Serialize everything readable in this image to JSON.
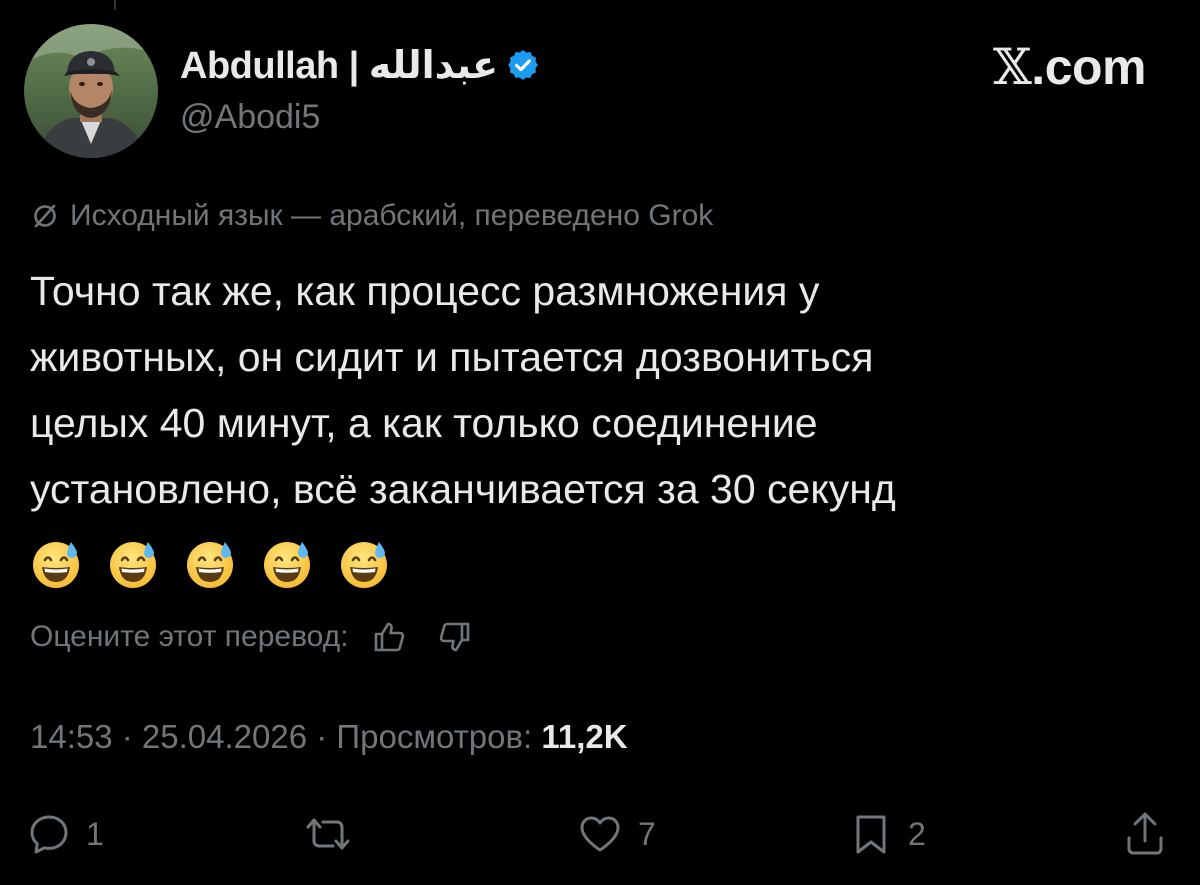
{
  "author": {
    "display_name": "Abdullah | عبدالله",
    "handle": "@Abodi5",
    "verified": true
  },
  "brand": {
    "symbol": "𝕏",
    "domain": ".com"
  },
  "translation": {
    "note": "Исходный язык — арабский, переведено Grok"
  },
  "tweet": {
    "lines": [
      "Точно так же, как процесс размножения у",
      "животных, он сидит и пытается дозвониться",
      "целых 40 минут, а как только соединение",
      "установлено, всё заканчивается за 30 секунд"
    ],
    "emoji": [
      "😅",
      "😅",
      "😅",
      "😅",
      "😅"
    ]
  },
  "rate": {
    "label": "Оцените этот перевод:"
  },
  "meta": {
    "time": "14:53",
    "separator": " · ",
    "date": "25.04.2026",
    "views_label": "Просмотров:",
    "views_count": "11,2K"
  },
  "actions": {
    "reply_count": "1",
    "repost_count": "",
    "like_count": "7",
    "bookmark_count": "2"
  },
  "icons": {
    "verified": "verified-badge-icon",
    "translate": "translate-globe-icon",
    "thumbs_up": "thumbs-up-icon",
    "thumbs_down": "thumbs-down-icon",
    "reply": "speech-bubble-icon",
    "repost": "repost-arrows-icon",
    "like": "heart-icon",
    "bookmark": "bookmark-icon",
    "share": "share-upload-icon"
  },
  "colors": {
    "background": "#000000",
    "text_primary": "#e7e9ea",
    "text_secondary": "#71767b",
    "verified_blue": "#1d9bf0"
  }
}
